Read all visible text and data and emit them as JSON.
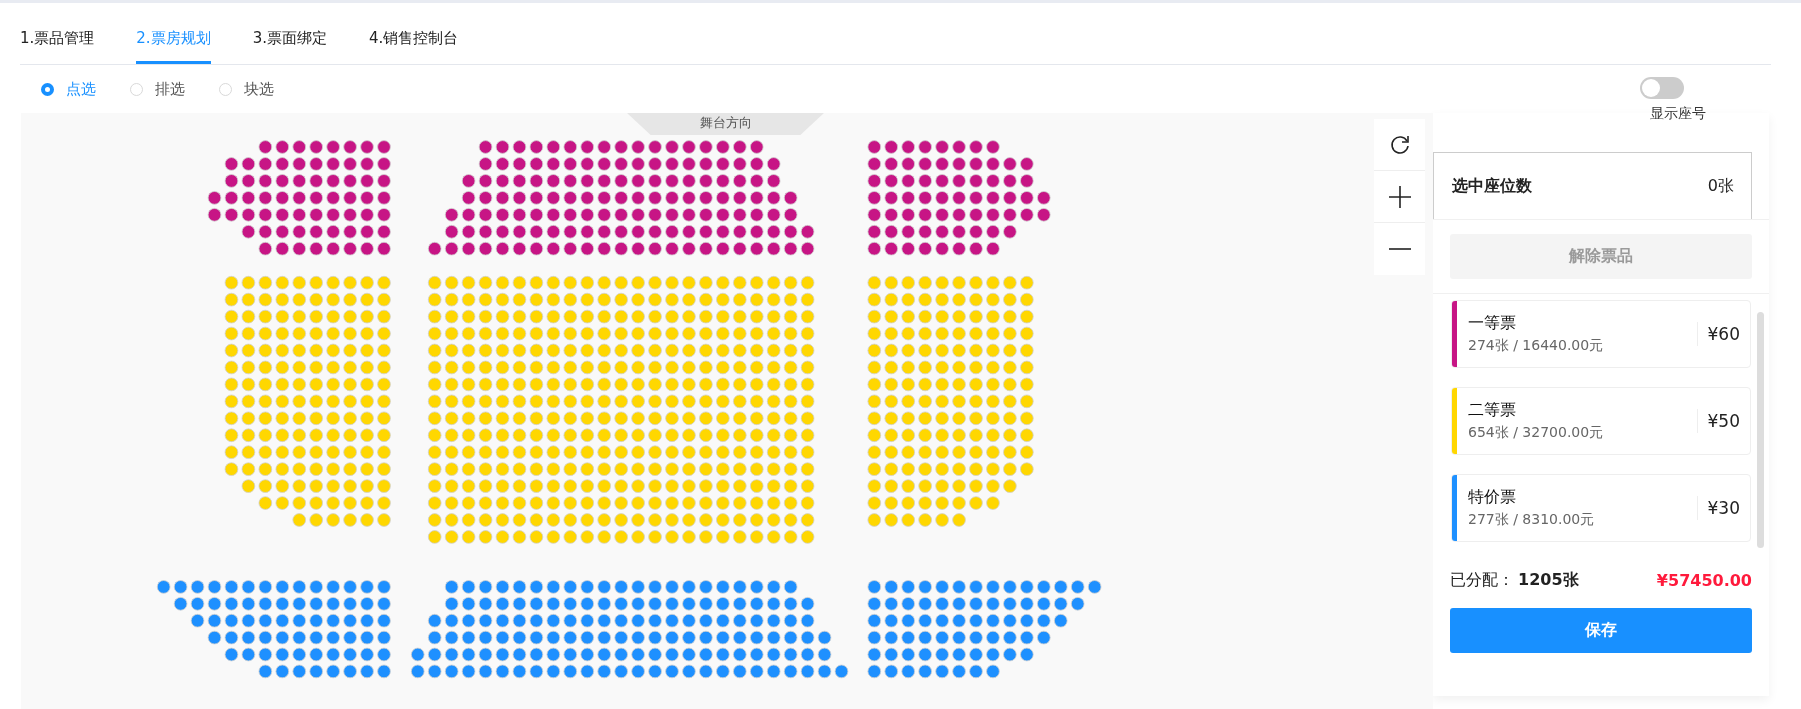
{
  "tabs": [
    {
      "label": "1.票品管理",
      "selected": false
    },
    {
      "label": "2.票房规划",
      "selected": true
    },
    {
      "label": "3.票面绑定",
      "selected": false
    },
    {
      "label": "4.销售控制台",
      "selected": false
    }
  ],
  "select_modes": [
    {
      "label": "点选",
      "selected": true
    },
    {
      "label": "排选",
      "selected": false
    },
    {
      "label": "块选",
      "selected": false
    }
  ],
  "seat_map": {
    "stage_label": "舞台方向"
  },
  "seat_number_toggle": {
    "label": "显示座号",
    "on": false
  },
  "selection": {
    "label": "选中座位数",
    "count": "0张"
  },
  "release_button": {
    "label": "解除票品",
    "disabled": true
  },
  "tickets": [
    {
      "name": "一等票",
      "summary": "274张 / 16440.00元",
      "price": "¥60",
      "color": "#c71585"
    },
    {
      "name": "二等票",
      "summary": "654张 / 32700.00元",
      "price": "¥50",
      "color": "#ffd700"
    },
    {
      "name": "特价票",
      "summary": "277张 / 8310.00元",
      "price": "¥30",
      "color": "#1e90ff"
    }
  ],
  "allocated": {
    "label": "已分配：",
    "count": "1205张",
    "total": "¥57450.00"
  },
  "save_button": {
    "label": "保存"
  }
}
